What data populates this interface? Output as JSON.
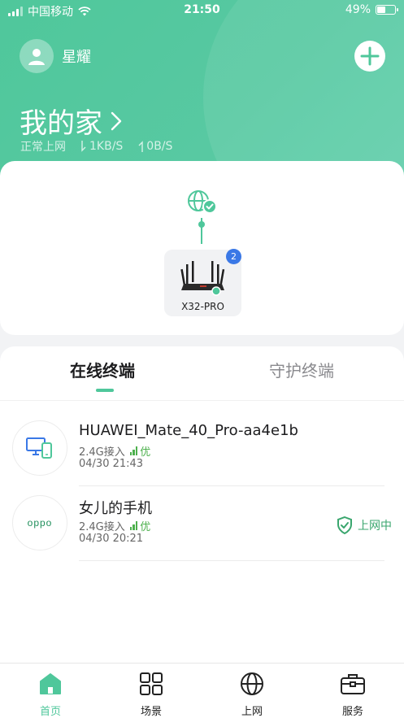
{
  "status_bar": {
    "carrier": "中国移动",
    "time": "21:50",
    "battery": "49%"
  },
  "header": {
    "user_name": "星耀",
    "home_title": "我的家",
    "status": "正常上网",
    "download": "1KB/S",
    "upload": "0B/S"
  },
  "topology": {
    "router_name": "X32-PRO",
    "router_badge": "2"
  },
  "tabs": {
    "online": "在线终端",
    "guarded": "守护终端"
  },
  "devices": [
    {
      "name": "HUAWEI_Mate_40_Pro-aa4e1b",
      "band": "2.4G接入",
      "quality": "优",
      "time": "04/30 21:43"
    },
    {
      "name": "女儿的手机",
      "band": "2.4G接入",
      "quality": "优",
      "time": "04/30 20:21",
      "logo": "oppo",
      "badge": "上网中"
    }
  ],
  "bottom_nav": {
    "home": "首页",
    "scene": "场景",
    "internet": "上网",
    "service": "服务"
  },
  "colors": {
    "accent": "#4fc79b",
    "badge_blue": "#3a78e6",
    "good_green": "#4cb04c"
  }
}
